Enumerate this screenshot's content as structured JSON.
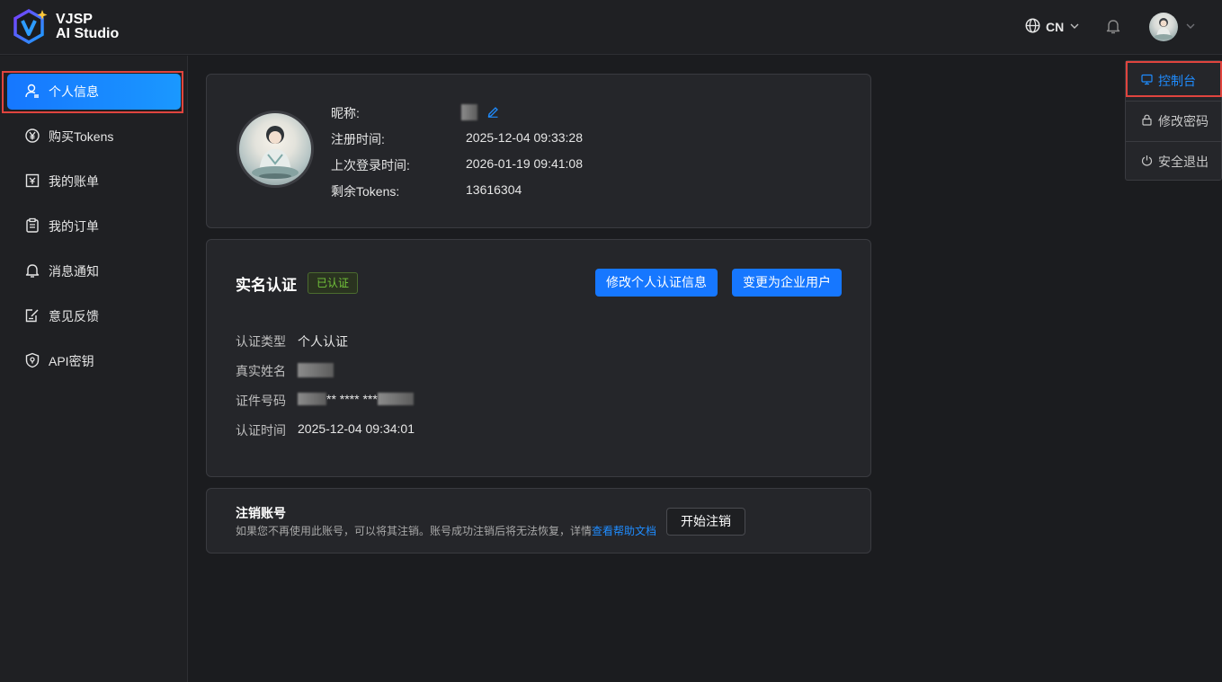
{
  "brand": {
    "line1": "VJSP",
    "line2": "AI Studio"
  },
  "header": {
    "language": "CN"
  },
  "sidebar": {
    "items": [
      {
        "label": "个人信息"
      },
      {
        "label": "购买Tokens"
      },
      {
        "label": "我的账单"
      },
      {
        "label": "我的订单"
      },
      {
        "label": "消息通知"
      },
      {
        "label": "意见反馈"
      },
      {
        "label": "API密钥"
      }
    ]
  },
  "profile": {
    "nickname_label": "昵称:",
    "register_label": "注册时间:",
    "register_value": "2025-12-04 09:33:28",
    "last_login_label": "上次登录时间:",
    "last_login_value": "2026-01-19 09:41:08",
    "tokens_label": "剩余Tokens:",
    "tokens_value": "13616304"
  },
  "verification": {
    "title": "实名认证",
    "status_badge": "已认证",
    "edit_button": "修改个人认证信息",
    "switch_button": "变更为企业用户",
    "type_label": "认证类型",
    "type_value": "个人认证",
    "name_label": "真实姓名",
    "id_label": "证件号码",
    "id_value": "** **** ***",
    "time_label": "认证时间",
    "time_value": "2025-12-04 09:34:01"
  },
  "cancel_account": {
    "title": "注销账号",
    "description": "如果您不再使用此账号，可以将其注销。账号成功注销后将无法恢复，详情",
    "help_link": "查看帮助文档",
    "button": "开始注销"
  },
  "user_menu": {
    "items": [
      {
        "label": "控制台"
      },
      {
        "label": "修改密码"
      },
      {
        "label": "安全退出"
      }
    ]
  },
  "colors": {
    "accent": "#1677ff",
    "success": "#73c43b",
    "highlight": "#e0443e"
  }
}
